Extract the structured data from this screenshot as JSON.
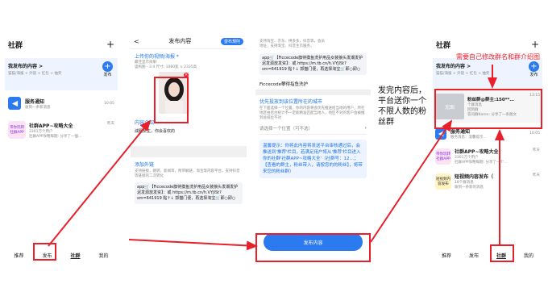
{
  "p1": {
    "title": "社群",
    "plus": "+",
    "mine_title": "我发布的内容 >",
    "mine_sub": "猫猫/海报 + 外链 + 红包 + 抽奖",
    "publish": "发布",
    "notice_title": "服务通知",
    "notice_sub": "收到一条新消息",
    "notice_time": "10:05",
    "group_title": "社群APP~攻略大全",
    "group_sub1": "3301万个用户",
    "group_sub2": "社群APP攻略每期: 分享了一個…",
    "group_time": "昨天",
    "group_badge": "带你玩转社群APP",
    "tabs": [
      "推荐",
      "发布",
      "社群",
      "我的"
    ]
  },
  "p2": {
    "back": "<",
    "header": "发布内容",
    "rule": "發布規則",
    "upload_title": "上传你的视频/海报 *",
    "upload_sub1": "最佳显示效果:",
    "upload_sub2": "竖构图 - 3:4 尺寸: 1080宽 × 2335高",
    "intro_title": "内容介绍",
    "intro_text": "減肥女生，你会喜欢的",
    "link_title": "添加外链",
    "link_sub": "支持链接，跳转，新闻等，附带解链，淘宝等内容平台，支持抖音等链接的二次转化",
    "link_text": "app🛒【Ficcecode旗待摸鱼洗护用品女装狼头发潮发护泥发源放发资】：或 https://m.tb.cn/h.VYJISt?sm=641919 點↑↓ 郭猫门便，再选择淘宝🛒即○即○"
  },
  "p3": {
    "top_text1": "支持淘宝、京东、拼多多、抖音等，会员",
    "top_text2": "地址，支持淘宝、抖音主页服务，",
    "block_text": "app🛒【Ficcecode旗待摸鱼洗护用品女装狼头发潮发护泥发源放发资】：或 https://m.tb.cn/h.VYJISt?sm=641919 點↑↓ 郭猫门便，再选择淘宝🛒即○即○",
    "brand": "Ficcecode攀得指鱼洗护",
    "pos_title": "优先投放到该位置所在的城市",
    "pos_sub": "在下面选择一个位置，你的内容将会优先推送给当地的用户，所在地区由后台统计不一定能精准匹配当地人，地区不对的客户会被推到总排位不对",
    "pos_select": "请选择一个位置（可不选）",
    "tip": "温馨提示：你将此内容将发送平台审核通过后，会推送到'推荐'栏目，若满足用户将从'推荐'栏目进入你的社群'社群APP~攻略大全'（社群号：12…；【查看的群主，粉丝带入，请按您的的粉丝】，将带来您的粉丝群）",
    "button": "发布内容"
  },
  "p4": {
    "title": "社群",
    "plus": "+",
    "mine_title": "我发布的内容 >",
    "mine_sub": "猫猫/海报 + 外链 + 红包 + 抽奖",
    "publish": "发布",
    "fan_title": "粉丝群@群主:150**…",
    "fan_sub1": "个群消息",
    "fan_sub2": "回到群",
    "fan_sub3": "答问群Karen: 分享了一条图文",
    "fan_time": "13:15",
    "fan_thumb": "无图",
    "notice_title": "服务通知",
    "notice_sub": "服务消息：温馨提示…",
    "notice_time": "10:05",
    "g1_title": "社群APP~攻略大全",
    "g1_sub1": "3301万个用户",
    "g1_sub2": "社群APP攻略每期: 分享了一个…",
    "g1_time": "昨天",
    "g1_badge": "带你玩转社群APP",
    "g2_title": "短视频内容发布（",
    "g2_sub1": "18个群消息",
    "g2_sub2": "收到一条新的消息",
    "g2_time": "昨天",
    "g2_badge": "短视频内容发布",
    "tabs": [
      "推荐",
      "发布",
      "社群",
      "我的"
    ]
  },
  "notes": {
    "mid": "发完内容后，平台送你一个不限人数的粉丝群",
    "right": "需要自己修改群名和群介绍图"
  },
  "colors": {
    "red": "#e8202b",
    "blue": "#1a73e8",
    "publish_btn": "#2b7af0"
  }
}
